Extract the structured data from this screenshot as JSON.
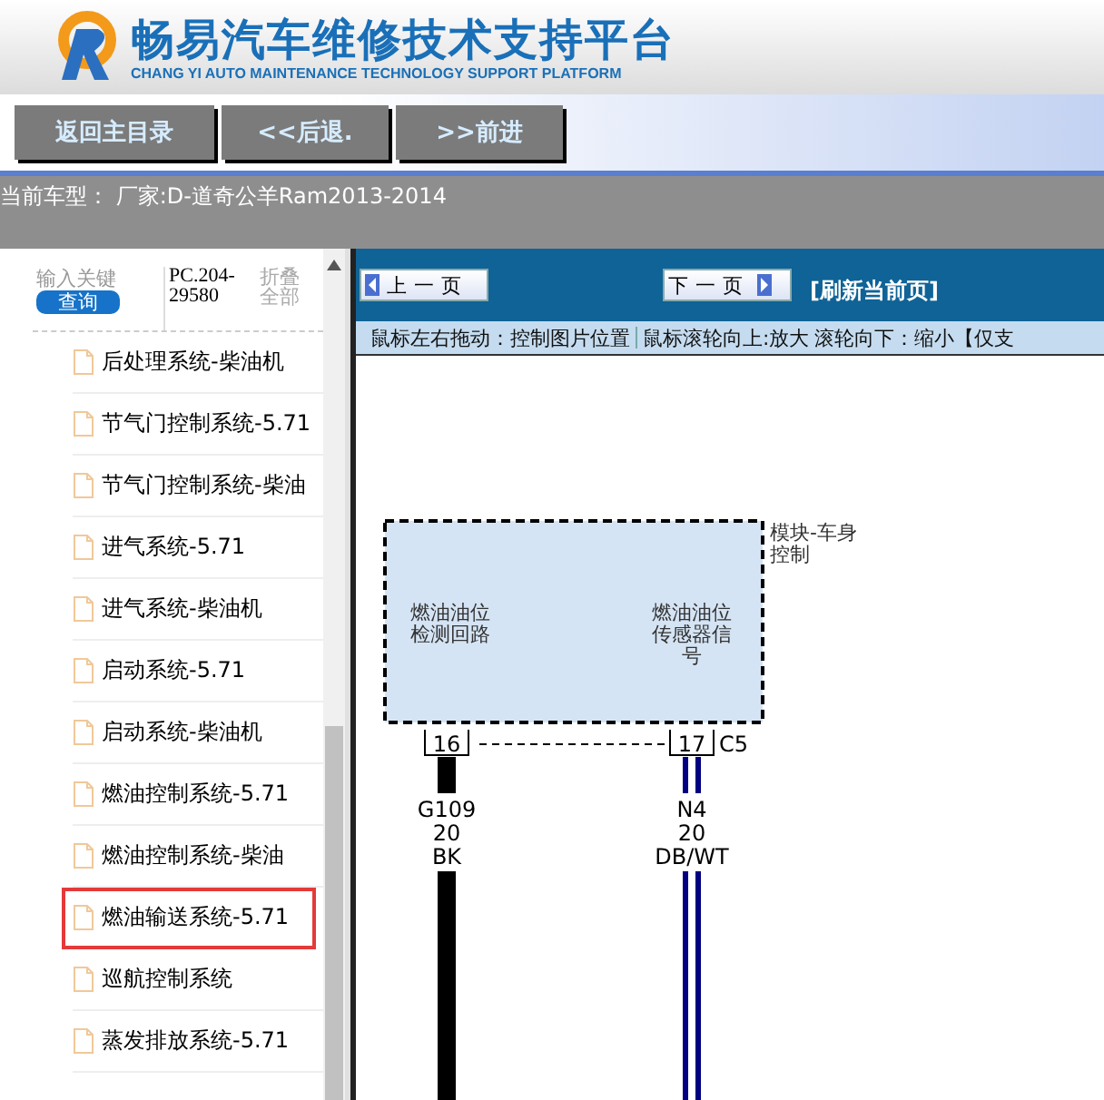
{
  "header": {
    "title": "畅易汽车维修技术支持平台",
    "subtitle": "CHANG YI AUTO MAINTENANCE TECHNOLOGY SUPPORT PLATFORM"
  },
  "nav_buttons": [
    "返回主目录",
    "<<后退.",
    ">>前进"
  ],
  "car_model": "当前车型：  厂家:D-道奇公羊Ram2013-2014",
  "sidebar": {
    "search": {
      "placeholder": "输入关键"
    },
    "search_button": "查询",
    "code": "PC.204-29580",
    "collapse": "折叠全部",
    "items": [
      {
        "label": "后处理系统-柴油机",
        "selected": false
      },
      {
        "label": "节气门控制系统-5.71",
        "selected": false
      },
      {
        "label": "节气门控制系统-柴油",
        "selected": false
      },
      {
        "label": "进气系统-5.71",
        "selected": false
      },
      {
        "label": "进气系统-柴油机",
        "selected": false
      },
      {
        "label": "启动系统-5.71",
        "selected": false
      },
      {
        "label": "启动系统-柴油机",
        "selected": false
      },
      {
        "label": "燃油控制系统-5.71",
        "selected": false
      },
      {
        "label": "燃油控制系统-柴油",
        "selected": false
      },
      {
        "label": "燃油输送系统-5.71",
        "selected": true
      },
      {
        "label": "巡航控制系统",
        "selected": false
      },
      {
        "label": "蒸发排放系统-5.71",
        "selected": false
      }
    ]
  },
  "viewer": {
    "prev": "上一页",
    "next": "下一页",
    "refresh": "[刷新当前页]",
    "hints": [
      "鼠标左右拖动：控制图片位置",
      "鼠标滚轮向上:放大",
      "滚轮向下：缩小【仅支"
    ]
  },
  "diagram": {
    "module_label": [
      "模块-车身",
      "控制"
    ],
    "connector": "C5",
    "pins": [
      {
        "number": "16",
        "function": [
          "燃油油位",
          "检测回路"
        ],
        "circuit": "G109",
        "gauge": "20",
        "color_code": "BK",
        "kind": "solid",
        "color": "#000000"
      },
      {
        "number": "17",
        "function": [
          "燃油油位",
          "传感器信",
          "号"
        ],
        "circuit": "N4",
        "gauge": "20",
        "color_code": "DB/WT",
        "kind": "stripe",
        "color": "#000080"
      }
    ]
  }
}
